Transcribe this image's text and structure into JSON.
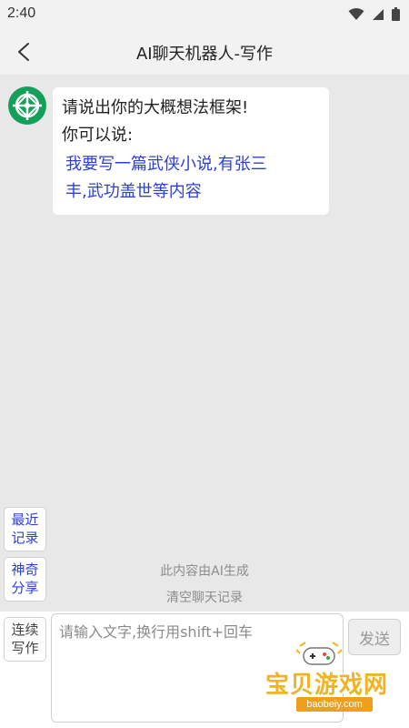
{
  "status_bar": {
    "time": "2:40"
  },
  "header": {
    "title": "AI聊天机器人-写作"
  },
  "chat": {
    "messages": [
      {
        "sender": "bot",
        "lines": [
          "请说出你的大概想法框架!",
          "你可以说:"
        ],
        "suggestion_lines": [
          "我要写一篇武侠小说,有张三",
          "丰,武功盖世等内容"
        ]
      }
    ]
  },
  "side_buttons": {
    "recent": [
      "最近",
      "记录"
    ],
    "magic_share": [
      "神奇",
      "分享"
    ]
  },
  "notice": {
    "ai_generated": "此内容由AI生成",
    "clear_history": "清空聊天记录"
  },
  "composer": {
    "continue_button": [
      "连续",
      "写作"
    ],
    "placeholder": "请输入文字,换行用shift+回车",
    "value": "",
    "send_label": "发送"
  },
  "watermark": {
    "title": "宝贝游戏网",
    "url": "baobeiy.com"
  },
  "colors": {
    "accent_green": "#15a05a",
    "link_blue": "#2c3fd6",
    "watermark_orange": "#f1b321"
  }
}
